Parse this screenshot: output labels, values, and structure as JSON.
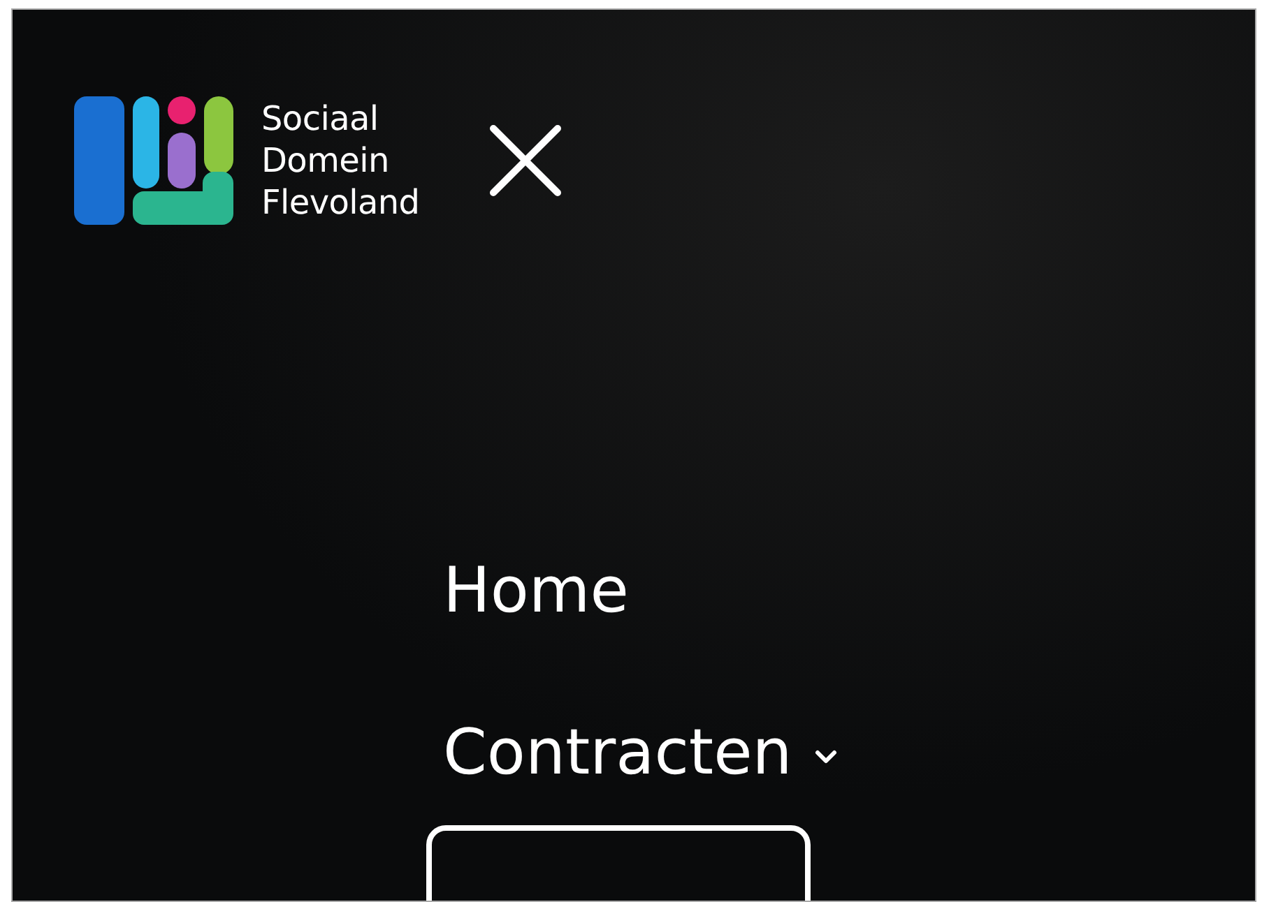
{
  "header": {
    "logo_text": [
      "Sociaal",
      "Domein",
      "Flevoland"
    ]
  },
  "menu": [
    {
      "label": "Home",
      "kind": "link"
    },
    {
      "label": "Contracten",
      "kind": "dropdown",
      "expanded": true
    }
  ]
}
